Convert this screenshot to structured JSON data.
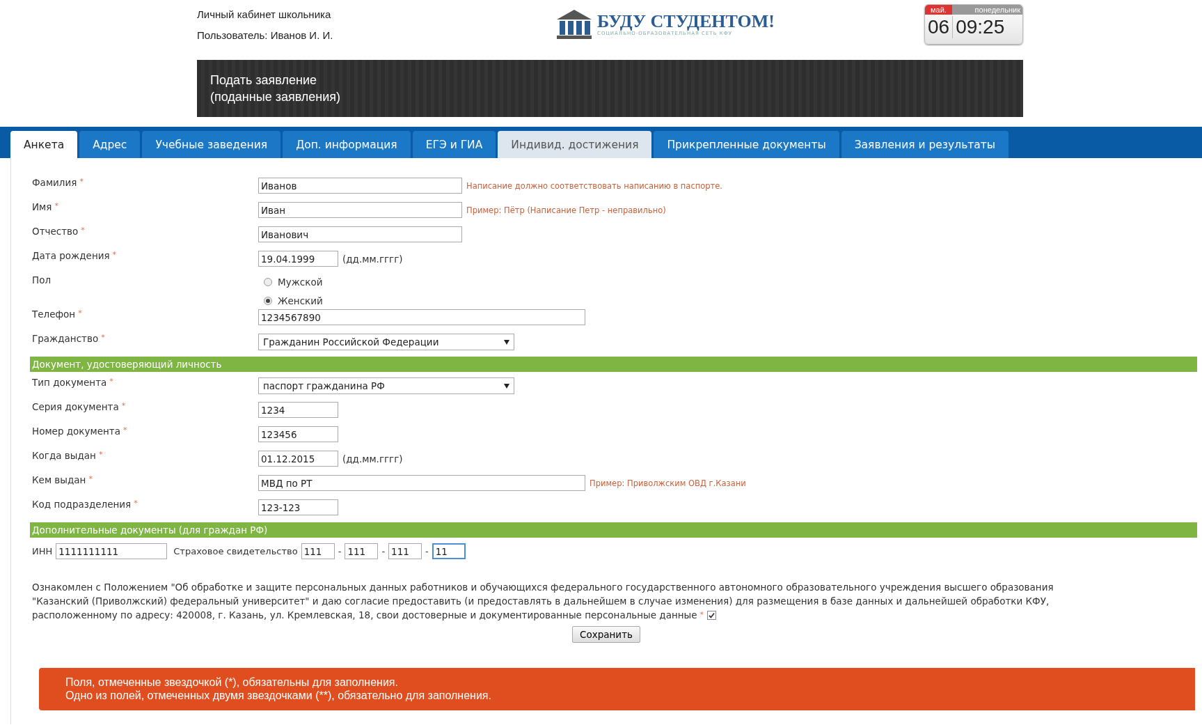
{
  "header": {
    "title": "Личный кабинет школьника",
    "user": "Пользователь: Иванов И. И.",
    "logo": {
      "name": "БУДУ СТУДЕНТОМ!",
      "subtitle": "СОЦИАЛЬНО-ОБРАЗОВАТЕЛЬНАЯ СЕТЬ КФУ"
    },
    "clock": {
      "month": "май.",
      "weekday": "понедельник",
      "day": "06",
      "time": "09:25"
    }
  },
  "banner": {
    "lines": [
      "Подать заявление",
      "(поданные заявления)"
    ]
  },
  "tabs": [
    {
      "label": "Анкета",
      "selected": true,
      "highlighted": false
    },
    {
      "label": "Адрес",
      "selected": false,
      "highlighted": false
    },
    {
      "label": "Учебные заведения",
      "selected": false,
      "highlighted": false
    },
    {
      "label": "Доп. информация",
      "selected": false,
      "highlighted": false
    },
    {
      "label": "ЕГЭ и ГИА",
      "selected": false,
      "highlighted": false
    },
    {
      "label": "Индивид. достижения",
      "selected": false,
      "highlighted": true
    },
    {
      "label": "Прикрепленные документы",
      "selected": false,
      "highlighted": false
    },
    {
      "label": "Заявления и результаты",
      "selected": false,
      "highlighted": false
    }
  ],
  "sections": [
    {
      "rows": [
        {
          "kind": "text",
          "label": "Фамилия",
          "required": "*",
          "value": "Иванов",
          "hint": "Написание должно соответствовать написанию в паспорте."
        },
        {
          "kind": "text",
          "label": "Имя",
          "required": "*",
          "value": "Иван",
          "hint": "Пример: Пётр (Написание Петр - неправильно)"
        },
        {
          "kind": "text",
          "label": "Отчество",
          "required": "*",
          "value": "Иванович"
        },
        {
          "kind": "date",
          "label": "Дата рождения",
          "required": "*",
          "value": "19.04.1999",
          "format": "(дд.мм.гггг)"
        },
        {
          "kind": "radio",
          "label": "Пол",
          "options": [
            {
              "label": "Мужской",
              "selected": false
            },
            {
              "label": "Женский",
              "selected": true
            }
          ]
        },
        {
          "kind": "long",
          "label": "Телефон",
          "required": "*",
          "value": "1234567890"
        },
        {
          "kind": "select",
          "label": "Гражданство",
          "required": "*",
          "value": "Гражданин Российской Федерации"
        }
      ]
    },
    {
      "heading": "Документ, удостоверяющий личность",
      "rows": [
        {
          "kind": "select",
          "label": "Тип документа",
          "required": "*",
          "value": "паспорт гражданина РФ"
        },
        {
          "kind": "short",
          "label": "Серия документа",
          "required": "*",
          "value": "1234"
        },
        {
          "kind": "short",
          "label": "Номер документа",
          "required": "*",
          "value": "123456"
        },
        {
          "kind": "date",
          "label": "Когда выдан",
          "required": "*",
          "value": "01.12.2015",
          "format": "(дд.мм.гггг)"
        },
        {
          "kind": "long",
          "label": "Кем выдан",
          "required": "*",
          "value": "МВД по РТ",
          "hint": "Пример: Приволжским ОВД г.Казани"
        },
        {
          "kind": "short",
          "label": "Код подразделения",
          "required": "*",
          "value": "123-123"
        }
      ]
    },
    {
      "heading": "Дополнительные документы (для граждан РФ)",
      "inline": {
        "inn_label": "ИНН",
        "inn": "1111111111",
        "snils_label": "Страховое свидетельство",
        "separator": "-",
        "snils_parts": [
          "111",
          "111",
          "111",
          "11"
        ]
      }
    }
  ],
  "consent": {
    "lines": [
      "Ознакомлен с Положением \"Об обработке и защите персональных данных работников и обучающихся федерального государственного автономного образовательного учреждения высшего образования",
      "\"Казанский (Приволжский) федеральный университет\" и даю согласие предоставить (и предоставлять в дальнейшем в случае изменения) для размещения в базе данных и дальнейшей обработки КФУ,",
      "расположенному по адресу: 420008, г. Казань, ул. Кремлевская, 18, свои достоверные и документированные персональные данные"
    ],
    "required": "*",
    "checked": true
  },
  "save_button": "Сохранить",
  "notice": [
    "Поля, отмеченные звездочкой (*), обязательны для заполнения.",
    "Одно из полей, отмеченных двумя звездочками (**), обязательно для заполнения."
  ]
}
